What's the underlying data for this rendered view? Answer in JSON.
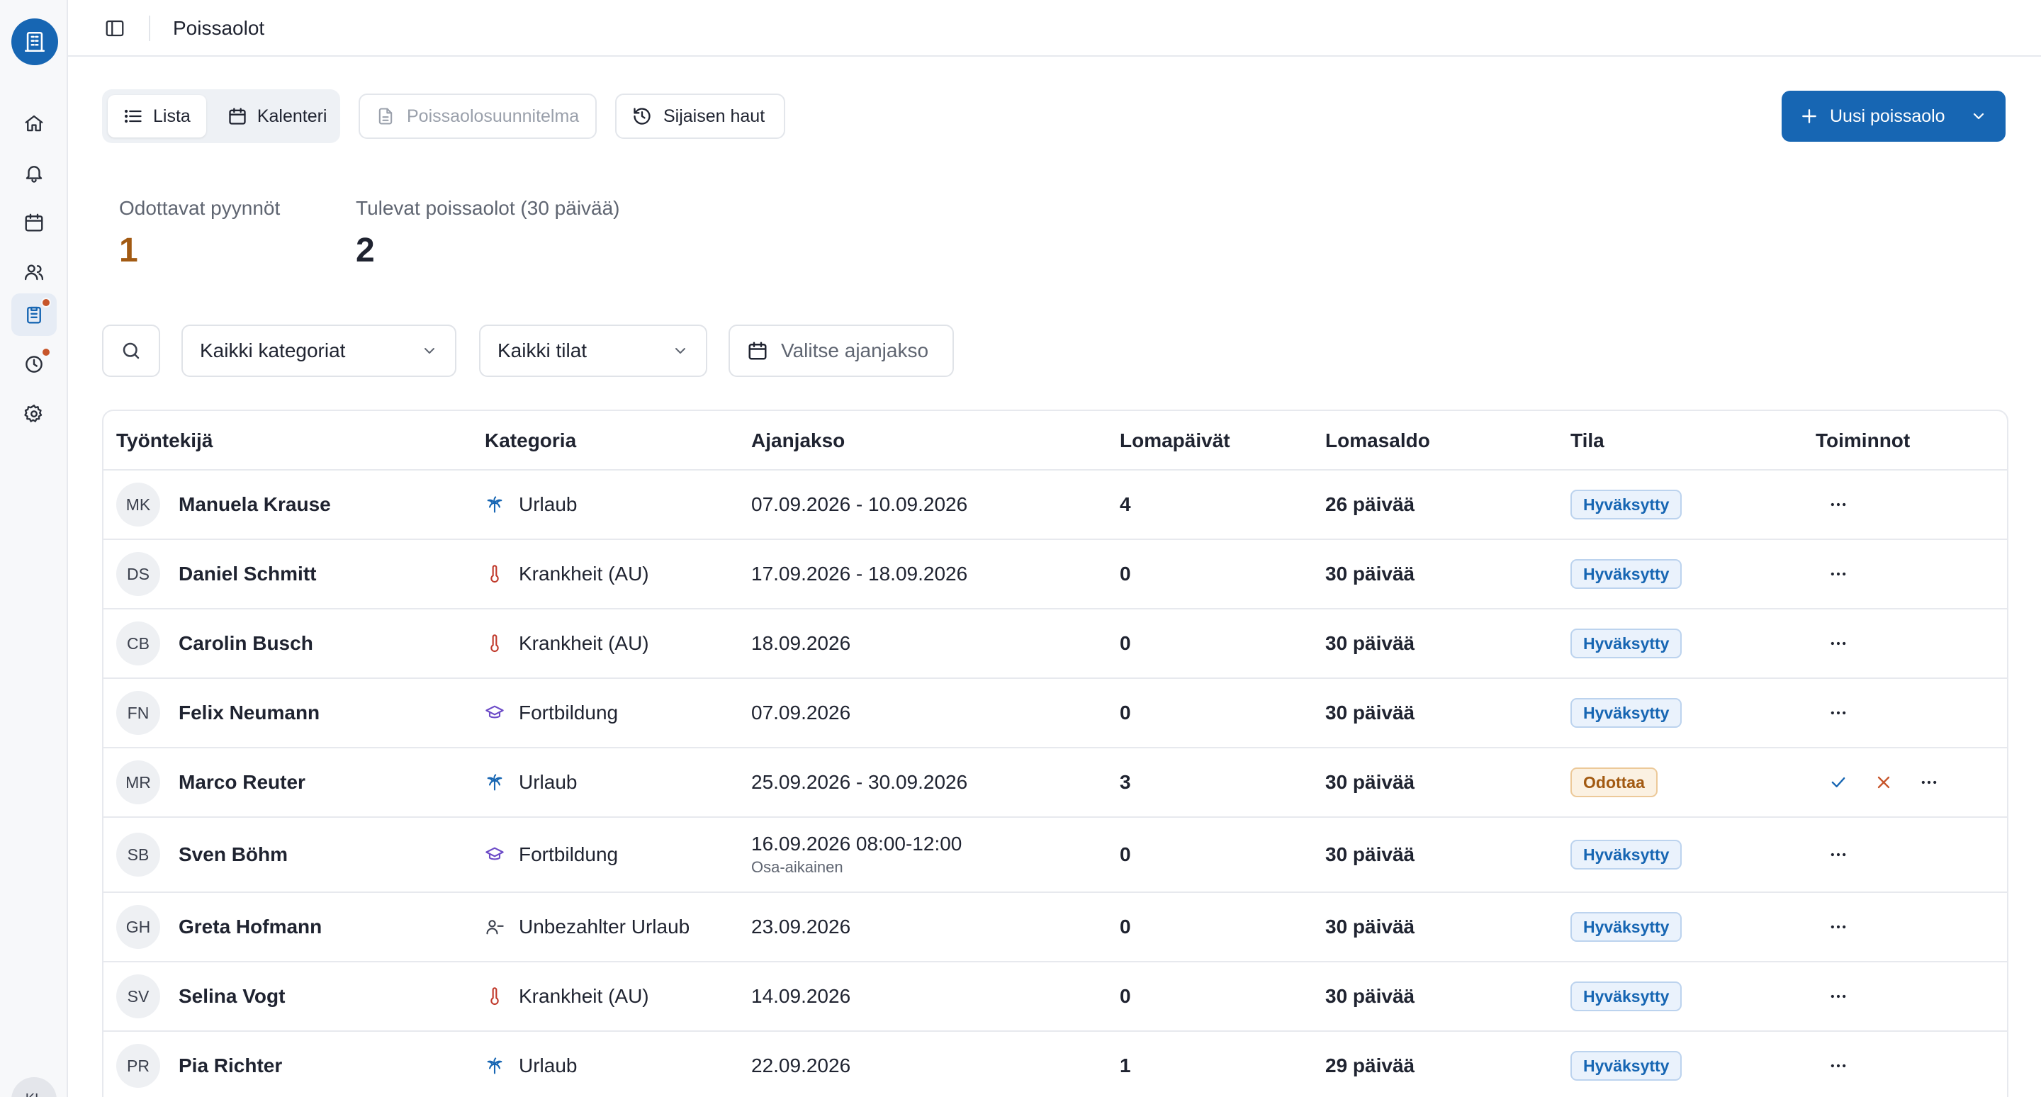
{
  "app": {
    "title": "Poissaolot",
    "user_initials": "KL",
    "accent": "#1766b3"
  },
  "sidebar": {
    "items": [
      {
        "name": "home-icon",
        "active": false,
        "badge": false
      },
      {
        "name": "bell-icon",
        "active": false,
        "badge": false
      },
      {
        "name": "calendar-icon",
        "active": false,
        "badge": false
      },
      {
        "name": "users-icon",
        "active": false,
        "badge": false
      },
      {
        "name": "clipboard-icon",
        "active": true,
        "badge": true
      },
      {
        "name": "clock-icon",
        "active": false,
        "badge": true
      },
      {
        "name": "gear-icon",
        "active": false,
        "badge": false
      }
    ]
  },
  "toolbar": {
    "view_list": "Lista",
    "view_calendar": "Kalenteri",
    "plan": "Poissaolosuunnitelma",
    "substitute": "Sijaisen haut",
    "new_absence": "Uusi poissaolo"
  },
  "stats": {
    "pending_label": "Odottavat pyynnöt",
    "pending_value": "1",
    "pending_color": "#a25a12",
    "upcoming_label": "Tulevat poissaolot (30 päivää)",
    "upcoming_value": "2"
  },
  "filters": {
    "category": "Kaikki kategoriat",
    "status": "Kaikki tilat",
    "date": "Valitse ajanjakso"
  },
  "table": {
    "headers": {
      "employee": "Työntekijä",
      "category": "Kategoria",
      "period": "Ajanjakso",
      "vacation_days": "Lomapäivät",
      "balance": "Lomasaldo",
      "status": "Tila",
      "actions": "Toiminnot"
    },
    "rows": [
      {
        "initials": "MK",
        "name": "Manuela Krause",
        "category": "Urlaub",
        "cat_icon": "palm-icon",
        "period": "07.09.2026 - 10.09.2026",
        "period_sub": "",
        "days": "4",
        "balance": "26 päivää",
        "status": "Hyväksytty",
        "status_type": "approved"
      },
      {
        "initials": "DS",
        "name": "Daniel Schmitt",
        "category": "Krankheit (AU)",
        "cat_icon": "thermometer-icon",
        "period": "17.09.2026 - 18.09.2026",
        "period_sub": "",
        "days": "0",
        "balance": "30 päivää",
        "status": "Hyväksytty",
        "status_type": "approved"
      },
      {
        "initials": "CB",
        "name": "Carolin Busch",
        "category": "Krankheit (AU)",
        "cat_icon": "thermometer-icon",
        "period": "18.09.2026",
        "period_sub": "",
        "days": "0",
        "balance": "30 päivää",
        "status": "Hyväksytty",
        "status_type": "approved"
      },
      {
        "initials": "FN",
        "name": "Felix Neumann",
        "category": "Fortbildung",
        "cat_icon": "graduation-cap-icon",
        "period": "07.09.2026",
        "period_sub": "",
        "days": "0",
        "balance": "30 päivää",
        "status": "Hyväksytty",
        "status_type": "approved"
      },
      {
        "initials": "MR",
        "name": "Marco Reuter",
        "category": "Urlaub",
        "cat_icon": "palm-icon",
        "period": "25.09.2026 - 30.09.2026",
        "period_sub": "",
        "days": "3",
        "balance": "30 päivää",
        "status": "Odottaa",
        "status_type": "pending"
      },
      {
        "initials": "SB",
        "name": "Sven Böhm",
        "category": "Fortbildung",
        "cat_icon": "graduation-cap-icon",
        "period": "16.09.2026 08:00-12:00",
        "period_sub": "Osa-aikainen",
        "days": "0",
        "balance": "30 päivää",
        "status": "Hyväksytty",
        "status_type": "approved"
      },
      {
        "initials": "GH",
        "name": "Greta Hofmann",
        "category": "Unbezahlter Urlaub",
        "cat_icon": "user-minus-icon",
        "period": "23.09.2026",
        "period_sub": "",
        "days": "0",
        "balance": "30 päivää",
        "status": "Hyväksytty",
        "status_type": "approved"
      },
      {
        "initials": "SV",
        "name": "Selina Vogt",
        "category": "Krankheit (AU)",
        "cat_icon": "thermometer-icon",
        "period": "14.09.2026",
        "period_sub": "",
        "days": "0",
        "balance": "30 päivää",
        "status": "Hyväksytty",
        "status_type": "approved"
      },
      {
        "initials": "PR",
        "name": "Pia Richter",
        "category": "Urlaub",
        "cat_icon": "palm-icon",
        "period": "22.09.2026",
        "period_sub": "",
        "days": "1",
        "balance": "29 päivää",
        "status": "Hyväksytty",
        "status_type": "approved"
      }
    ]
  }
}
